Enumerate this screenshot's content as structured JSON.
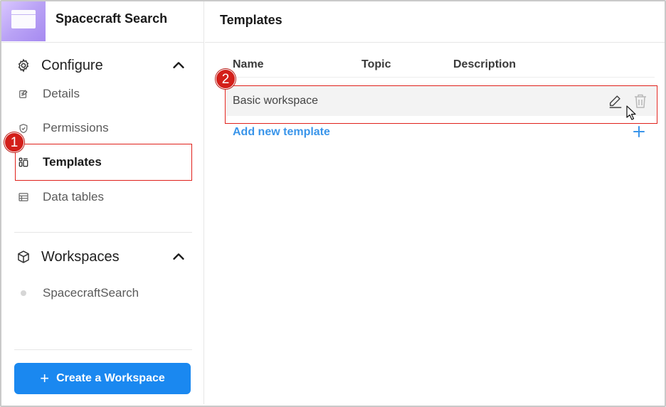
{
  "sidebar": {
    "app_title": "Spacecraft Search",
    "configure": {
      "label": "Configure",
      "items": [
        {
          "label": "Details",
          "icon": "edit-note-icon"
        },
        {
          "label": "Permissions",
          "icon": "shield-icon"
        },
        {
          "label": "Templates",
          "icon": "templates-icon"
        },
        {
          "label": "Data tables",
          "icon": "table-icon"
        }
      ]
    },
    "workspaces": {
      "label": "Workspaces",
      "items": [
        {
          "label": "SpacecraftSearch"
        }
      ]
    },
    "create_button": {
      "label": "Create a Workspace",
      "icon": "+"
    }
  },
  "main": {
    "title": "Templates",
    "columns": [
      "Name",
      "Topic",
      "Description"
    ],
    "rows": [
      {
        "name": "Basic workspace",
        "topic": "",
        "description": ""
      }
    ],
    "add_link": "Add new template"
  },
  "annotations": [
    "1",
    "2"
  ],
  "colors": {
    "accent": "#1a88f0",
    "link": "#3a95ea",
    "highlight": "#e0211b"
  }
}
